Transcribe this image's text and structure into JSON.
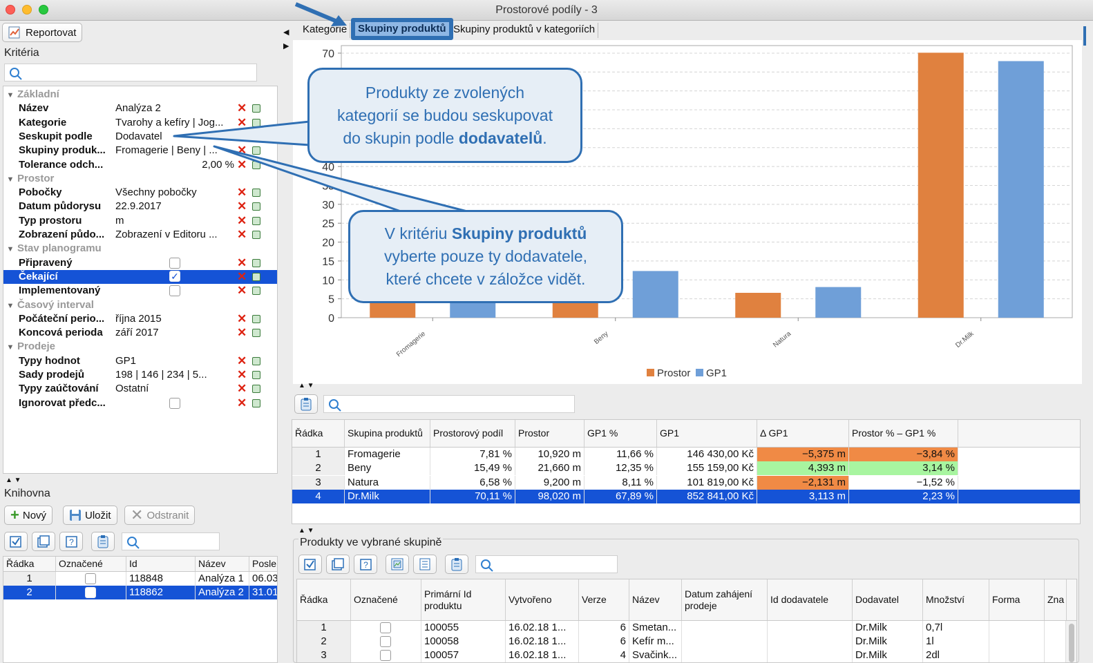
{
  "window": {
    "title": "Prostorové podíly - 3"
  },
  "toolbar": {
    "report_label": "Reportovat"
  },
  "criteria": {
    "title": "Kritéria",
    "groups": [
      {
        "name": "Základní",
        "rows": [
          {
            "label": "Název",
            "value": "Analýza 2"
          },
          {
            "label": "Kategorie",
            "value": "Tvarohy a kefíry | Jog..."
          },
          {
            "label": "Seskupit podle",
            "value": "Dodavatel"
          },
          {
            "label": "Skupiny produk...",
            "value": "Fromagerie | Beny | ..."
          },
          {
            "label": "Tolerance odch...",
            "value": "2,00 %"
          }
        ]
      },
      {
        "name": "Prostor",
        "rows": [
          {
            "label": "Pobočky",
            "value": "Všechny pobočky"
          },
          {
            "label": "Datum půdorysu",
            "value": "22.9.2017"
          },
          {
            "label": "Typ prostoru",
            "value": "m"
          },
          {
            "label": "Zobrazení půdo...",
            "value": "Zobrazení v Editoru ..."
          }
        ]
      },
      {
        "name": "Stav planogramu",
        "rows": [
          {
            "label": "Připravený",
            "checked": false
          },
          {
            "label": "Čekající",
            "checked": true
          },
          {
            "label": "Implementovaný",
            "checked": false
          }
        ]
      },
      {
        "name": "Časový interval",
        "rows": [
          {
            "label": "Počáteční perio...",
            "value": "října 2015"
          },
          {
            "label": "Koncová perioda",
            "value": "září 2017"
          }
        ]
      },
      {
        "name": "Prodeje",
        "rows": [
          {
            "label": "Typy hodnot",
            "value": "GP1"
          },
          {
            "label": "Sady prodejů",
            "value": "198 | 146 | 234 | 5..."
          },
          {
            "label": "Typy zaúčtování",
            "value": "Ostatní"
          },
          {
            "label": "Ignorovat předc...",
            "checked": false
          }
        ]
      }
    ]
  },
  "library": {
    "title": "Knihovna",
    "new_label": "Nový",
    "save_label": "Uložit",
    "delete_label": "Odstranit",
    "columns": [
      "Řádka",
      "Označené",
      "Id",
      "Název",
      "Posle"
    ],
    "rows": [
      {
        "row": "1",
        "id": "118848",
        "name": "Analýza 1",
        "last": "06.03"
      },
      {
        "row": "2",
        "id": "118862",
        "name": "Analýza 2",
        "last": "31.01"
      }
    ]
  },
  "tabs": [
    "Kategorie",
    "Skupiny produktů",
    "Skupiny produktů v kategoriích"
  ],
  "chart_data": {
    "type": "bar",
    "categories": [
      "Fromagerie",
      "Beny",
      "Natura",
      "Dr.Milk"
    ],
    "series": [
      {
        "name": "Prostor",
        "color": "#e0813f",
        "values": [
          7.81,
          15.49,
          6.58,
          70.11
        ]
      },
      {
        "name": "GP1",
        "color": "#6f9fd8",
        "values": [
          11.66,
          12.35,
          8.11,
          67.89
        ]
      }
    ],
    "yticks": [
      "0",
      "5",
      "10",
      "15",
      "20",
      "25",
      "30",
      "35",
      "40",
      "45",
      "50",
      "55",
      "60",
      "65",
      "70"
    ],
    "ylim": [
      0,
      72
    ],
    "grid": true,
    "legend": "bottom"
  },
  "callouts": {
    "top": {
      "line1": "Produkty ze zvolených",
      "line2": "kategorií se budou seskupovat",
      "line3_pre": "do skupin podle ",
      "line3_bold": "dodavatelů",
      "line3_post": "."
    },
    "bottom": {
      "line1_pre": "V kritériu ",
      "line1_bold": "Skupiny produktů",
      "line2": "vyberte pouze ty dodavatele,",
      "line3": "které chcete v záložce vidět."
    }
  },
  "groups_table": {
    "columns": [
      "Řádka",
      "Skupina produktů",
      "Prostorový podíl",
      "Prostor",
      "GP1 %",
      "GP1",
      "Δ GP1",
      "Prostor % – GP1 %"
    ],
    "rows": [
      {
        "row": "1",
        "group": "Fromagerie",
        "share": "7,81 %",
        "space": "10,920 m",
        "gp1pct": "11,66 %",
        "gp1": "146 430,00 Kč",
        "dgp1": "−5,375 m",
        "diff": "−3,84 %"
      },
      {
        "row": "2",
        "group": "Beny",
        "share": "15,49 %",
        "space": "21,660 m",
        "gp1pct": "12,35 %",
        "gp1": "155 159,00 Kč",
        "dgp1": "4,393 m",
        "diff": "3,14 %"
      },
      {
        "row": "3",
        "group": "Natura",
        "share": "6,58 %",
        "space": "9,200 m",
        "gp1pct": "8,11 %",
        "gp1": "101 819,00 Kč",
        "dgp1": "−2,131 m",
        "diff": "−1,52 %"
      },
      {
        "row": "4",
        "group": "Dr.Milk",
        "share": "70,11 %",
        "space": "98,020 m",
        "gp1pct": "67,89 %",
        "gp1": "852 841,00 Kč",
        "dgp1": "3,113 m",
        "diff": "2,23 %"
      }
    ]
  },
  "products": {
    "title": "Produkty ve vybrané skupině",
    "columns": [
      "Řádka",
      "Označené",
      "Primární Id produktu",
      "Vytvořeno",
      "Verze",
      "Název",
      "Datum zahájení prodeje",
      "Id dodavatele",
      "Dodavatel",
      "Množství",
      "Forma",
      "Zna"
    ],
    "rows": [
      {
        "row": "1",
        "pid": "100055",
        "created": "16.02.18 1...",
        "ver": "6",
        "name": "Smetan...",
        "supplier": "Dr.Milk",
        "qty": "0,7l"
      },
      {
        "row": "2",
        "pid": "100058",
        "created": "16.02.18 1...",
        "ver": "6",
        "name": "Kefír m...",
        "supplier": "Dr.Milk",
        "qty": "1l"
      },
      {
        "row": "3",
        "pid": "100057",
        "created": "16.02.18 1...",
        "ver": "4",
        "name": "Svačink...",
        "supplier": "Dr.Milk",
        "qty": "2dl"
      }
    ]
  },
  "colors": {
    "selection": "#1553d6",
    "negative": "#f08a45",
    "positive": "#a8f5a0",
    "callout": "#2f6fb3"
  }
}
